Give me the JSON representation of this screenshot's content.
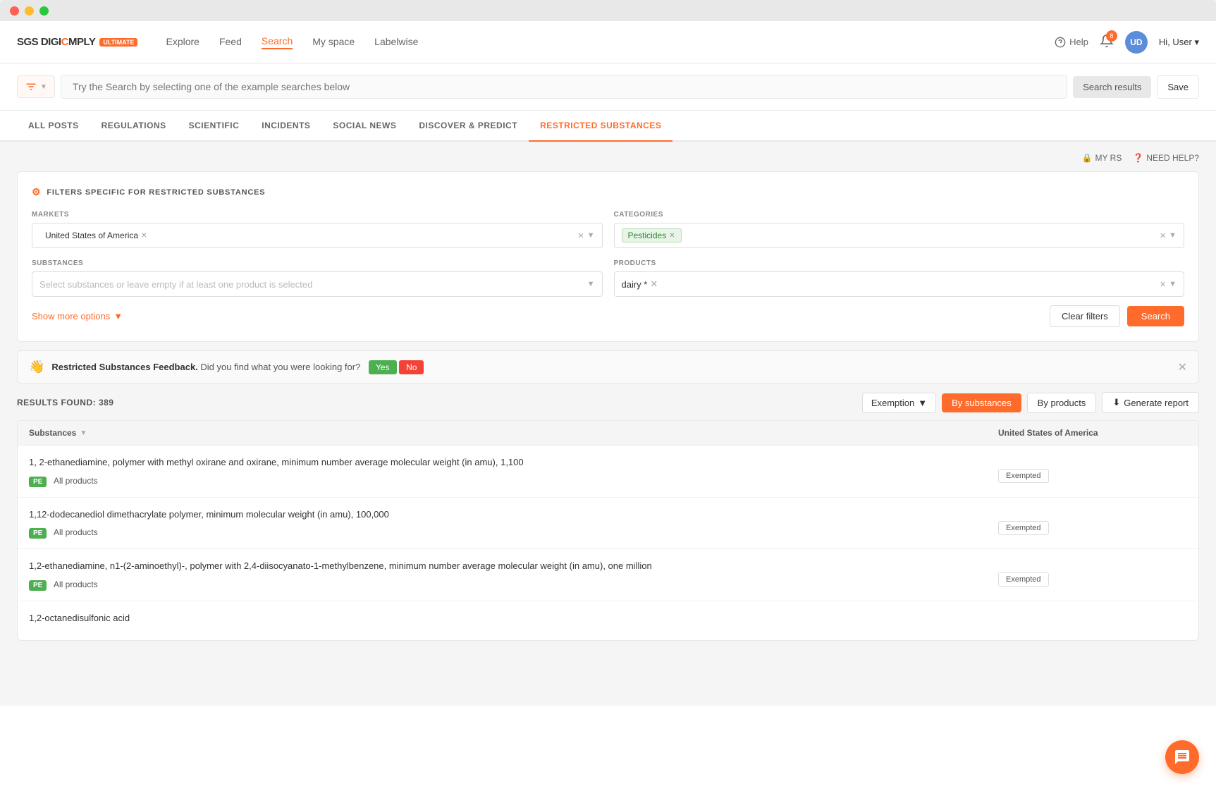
{
  "window": {
    "title": "SGS DigiComply"
  },
  "nav": {
    "logo_text": "SGS DIGICOMPLY",
    "logo_badge": "ULTIMATE",
    "links": [
      {
        "label": "Explore",
        "active": false
      },
      {
        "label": "Feed",
        "active": false
      },
      {
        "label": "Search",
        "active": true
      },
      {
        "label": "My space",
        "active": false
      },
      {
        "label": "Labelwise",
        "active": false
      }
    ],
    "help_label": "Help",
    "bell_count": "8",
    "user_initials": "UD",
    "user_greeting": "Hi, User"
  },
  "search_bar": {
    "placeholder": "Try the Search by selecting one of the example searches below",
    "search_results_label": "Search results",
    "save_label": "Save"
  },
  "tabs": [
    {
      "label": "ALL POSTS",
      "active": false
    },
    {
      "label": "REGULATIONS",
      "active": false
    },
    {
      "label": "SCIENTIFIC",
      "active": false
    },
    {
      "label": "INCIDENTS",
      "active": false
    },
    {
      "label": "SOCIAL NEWS",
      "active": false
    },
    {
      "label": "DISCOVER & PREDICT",
      "active": false
    },
    {
      "label": "RESTRICTED SUBSTANCES",
      "active": true
    }
  ],
  "rs_header": {
    "my_rs": "MY RS",
    "need_help": "NEED HELP?"
  },
  "filters": {
    "title": "FILTERS SPECIFIC FOR RESTRICTED SUBSTANCES",
    "markets_label": "MARKETS",
    "markets_value": "United States of America",
    "categories_label": "CATEGORIES",
    "categories_value": "Pesticides",
    "substances_label": "SUBSTANCES",
    "substances_placeholder": "Select substances or leave empty if at least one product is selected",
    "products_label": "PRODUCTS",
    "products_value": "dairy *",
    "show_more": "Show more options",
    "clear_filters": "Clear filters",
    "search": "Search"
  },
  "feedback": {
    "icon": "👋",
    "bold_text": "Restricted Substances Feedback.",
    "text": " Did you find what you were looking for?",
    "yes": "Yes",
    "no": "No"
  },
  "results": {
    "count_label": "RESULTS FOUND: 389",
    "exemption_label": "Exemption",
    "by_substances_label": "By substances",
    "by_products_label": "By products",
    "generate_report_label": "Generate report",
    "table_col1": "Substances",
    "table_col2": "United States of America",
    "rows": [
      {
        "name": "1, 2-ethanediamine, polymer with methyl oxirane and oxirane, minimum number average molecular weight (in amu), 1,100",
        "badge": "PE",
        "products": "All products",
        "status": "Exempted"
      },
      {
        "name": "1,12-dodecanediol dimethacrylate polymer, minimum molecular weight (in amu), 100,000",
        "badge": "PE",
        "products": "All products",
        "status": "Exempted"
      },
      {
        "name": "1,2-ethanediamine, n1-(2-aminoethyl)-, polymer with 2,4-diisocyanato-1-methylbenzene, minimum number average molecular weight (in amu), one million",
        "badge": "PE",
        "products": "All products",
        "status": "Exempted"
      },
      {
        "name": "1,2-octanedisulfonic acid",
        "badge": "",
        "products": "",
        "status": ""
      }
    ]
  }
}
